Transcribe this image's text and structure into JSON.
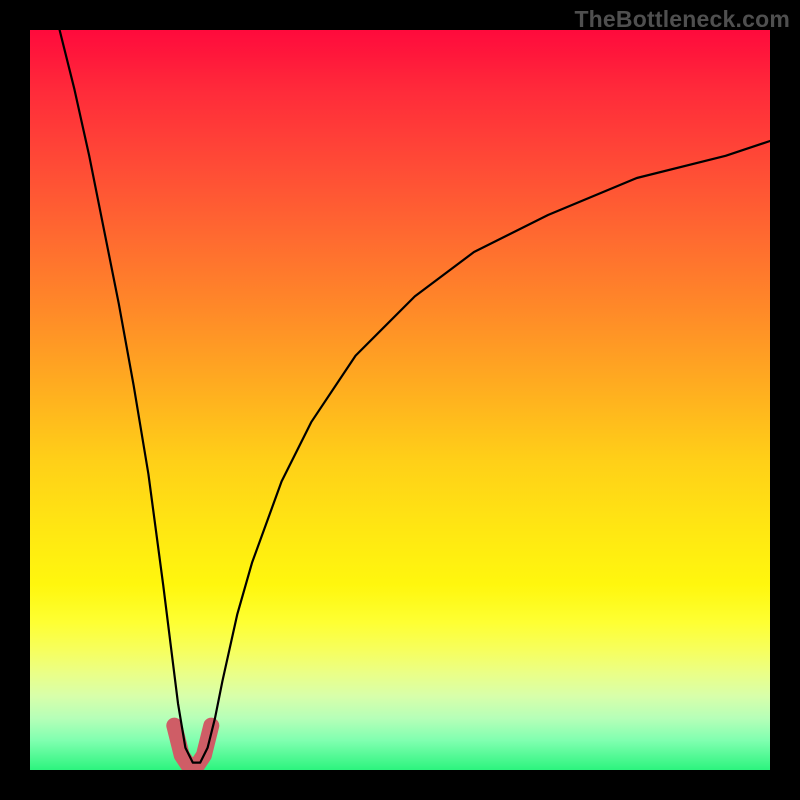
{
  "watermark": "TheBottleneck.com",
  "chart_data": {
    "type": "line",
    "title": "",
    "xlabel": "",
    "ylabel": "",
    "xlim": [
      0,
      100
    ],
    "ylim": [
      0,
      100
    ],
    "background_gradient": {
      "top": "#ff0a3c",
      "bottom": "#2cf47e",
      "meaning": "high (top, red) to low (bottom, green) bottleneck"
    },
    "series": [
      {
        "name": "bottleneck-curve",
        "description": "V-shaped curve: steep descent to minimum near x≈22, then asymptotic rise",
        "x": [
          4,
          6,
          8,
          10,
          12,
          14,
          16,
          18,
          19,
          20,
          21,
          22,
          23,
          24,
          25,
          26,
          28,
          30,
          34,
          38,
          44,
          52,
          60,
          70,
          82,
          94,
          100
        ],
        "y": [
          100,
          92,
          83,
          73,
          63,
          52,
          40,
          25,
          17,
          9,
          3,
          1,
          1,
          3,
          7,
          12,
          21,
          28,
          39,
          47,
          56,
          64,
          70,
          75,
          80,
          83,
          85
        ]
      },
      {
        "name": "valley-highlight",
        "description": "Short pink U segment marking the minimum region",
        "x": [
          19.5,
          20.5,
          21.5,
          22.5,
          23.5,
          24.5
        ],
        "y": [
          6,
          2,
          0.5,
          0.5,
          2,
          6
        ]
      }
    ]
  },
  "styles": {
    "curve_stroke": "#000000",
    "curve_width": 2.2,
    "highlight_stroke": "#cf5d66",
    "highlight_width": 16
  }
}
